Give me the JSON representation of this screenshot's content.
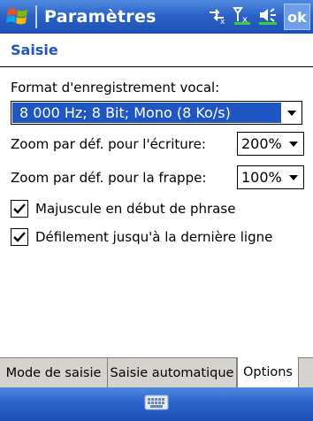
{
  "titlebar": {
    "title": "Paramètres",
    "ok_label": "ok",
    "icons": [
      "windows-flag-icon",
      "connectivity-icon",
      "signal-icon",
      "volume-icon"
    ]
  },
  "header": {
    "title": "Saisie"
  },
  "form": {
    "voice_format_label": "Format d'enregistrement vocal:",
    "voice_format_value": "8 000 Hz; 8 Bit; Mono (8 Ko/s)",
    "zoom_writing_label": "Zoom par déf. pour l'écriture:",
    "zoom_writing_value": "200%",
    "zoom_typing_label": "Zoom par déf. pour la frappe:",
    "zoom_typing_value": "100%",
    "checkbox_capitalize_label": "Majuscule en début de phrase",
    "checkbox_capitalize_checked": true,
    "checkbox_scroll_label": "Défilement jusqu'à la dernière ligne",
    "checkbox_scroll_checked": true
  },
  "tabs": [
    {
      "label": "Mode de saisie",
      "active": false
    },
    {
      "label": "Saisie automatique",
      "active": false
    },
    {
      "label": "Options",
      "active": true
    }
  ],
  "bottombar": {
    "icon": "keyboard-icon"
  },
  "colors": {
    "titlebar": "#2c63c8",
    "accent": "#1f56c2",
    "tab_bg": "#d6d3ce"
  }
}
